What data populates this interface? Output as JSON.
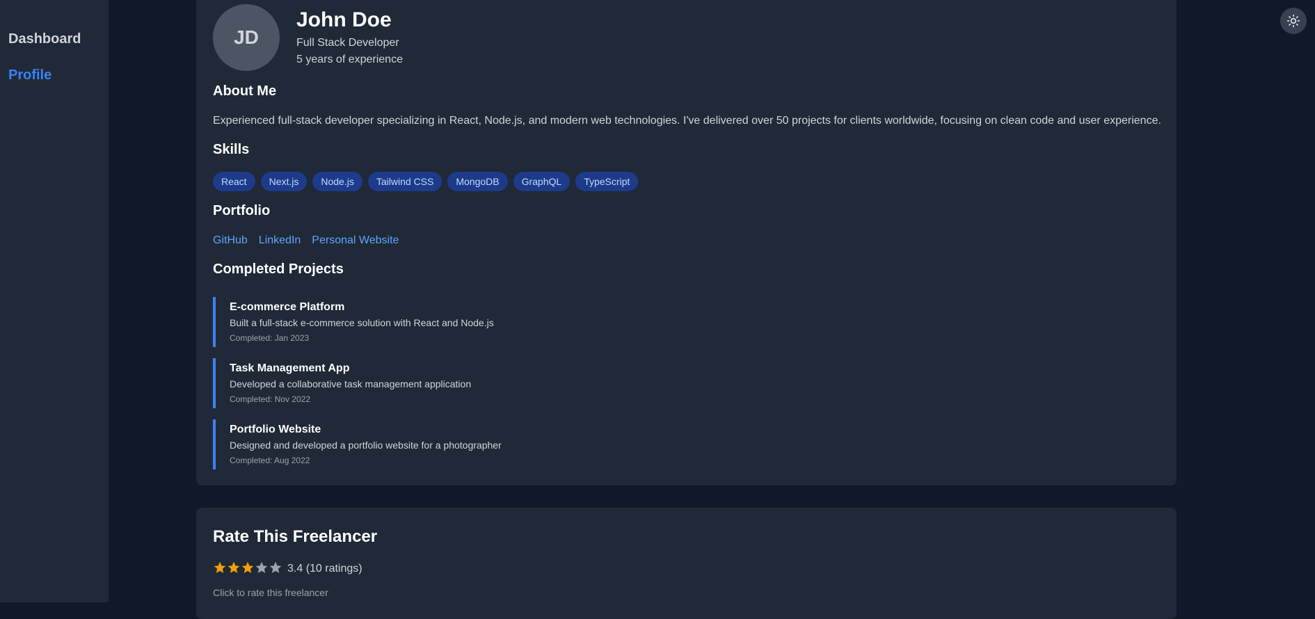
{
  "sidebar": {
    "items": [
      {
        "label": "Dashboard",
        "active": false
      },
      {
        "label": "Profile",
        "active": true
      }
    ]
  },
  "theme_toggle": {
    "icon": "sun-icon"
  },
  "profile": {
    "initials": "JD",
    "name": "John Doe",
    "role": "Full Stack Developer",
    "experience": "5 years of experience",
    "about_heading": "About Me",
    "about_text": "Experienced full-stack developer specializing in React, Node.js, and modern web technologies. I've delivered over 50 projects for clients worldwide, focusing on clean code and user experience.",
    "skills_heading": "Skills",
    "skills": [
      "React",
      "Next.js",
      "Node.js",
      "Tailwind CSS",
      "MongoDB",
      "GraphQL",
      "TypeScript"
    ],
    "portfolio_heading": "Portfolio",
    "portfolio_links": [
      "GitHub",
      "LinkedIn",
      "Personal Website"
    ],
    "projects_heading": "Completed Projects",
    "projects": [
      {
        "title": "E-commerce Platform",
        "description": "Built a full-stack e-commerce solution with React and Node.js",
        "date": "Completed: Jan 2023"
      },
      {
        "title": "Task Management App",
        "description": "Developed a collaborative task management application",
        "date": "Completed: Nov 2022"
      },
      {
        "title": "Portfolio Website",
        "description": "Designed and developed a portfolio website for a photographer",
        "date": "Completed: Aug 2022"
      }
    ]
  },
  "rating": {
    "title": "Rate This Freelancer",
    "stars_filled": 3,
    "stars_total": 5,
    "summary": "3.4 (10 ratings)",
    "hint": "Click to rate this freelancer"
  },
  "colors": {
    "accent": "#3b82f6",
    "star_filled": "#f59e0b",
    "star_empty": "#9ca3af"
  }
}
